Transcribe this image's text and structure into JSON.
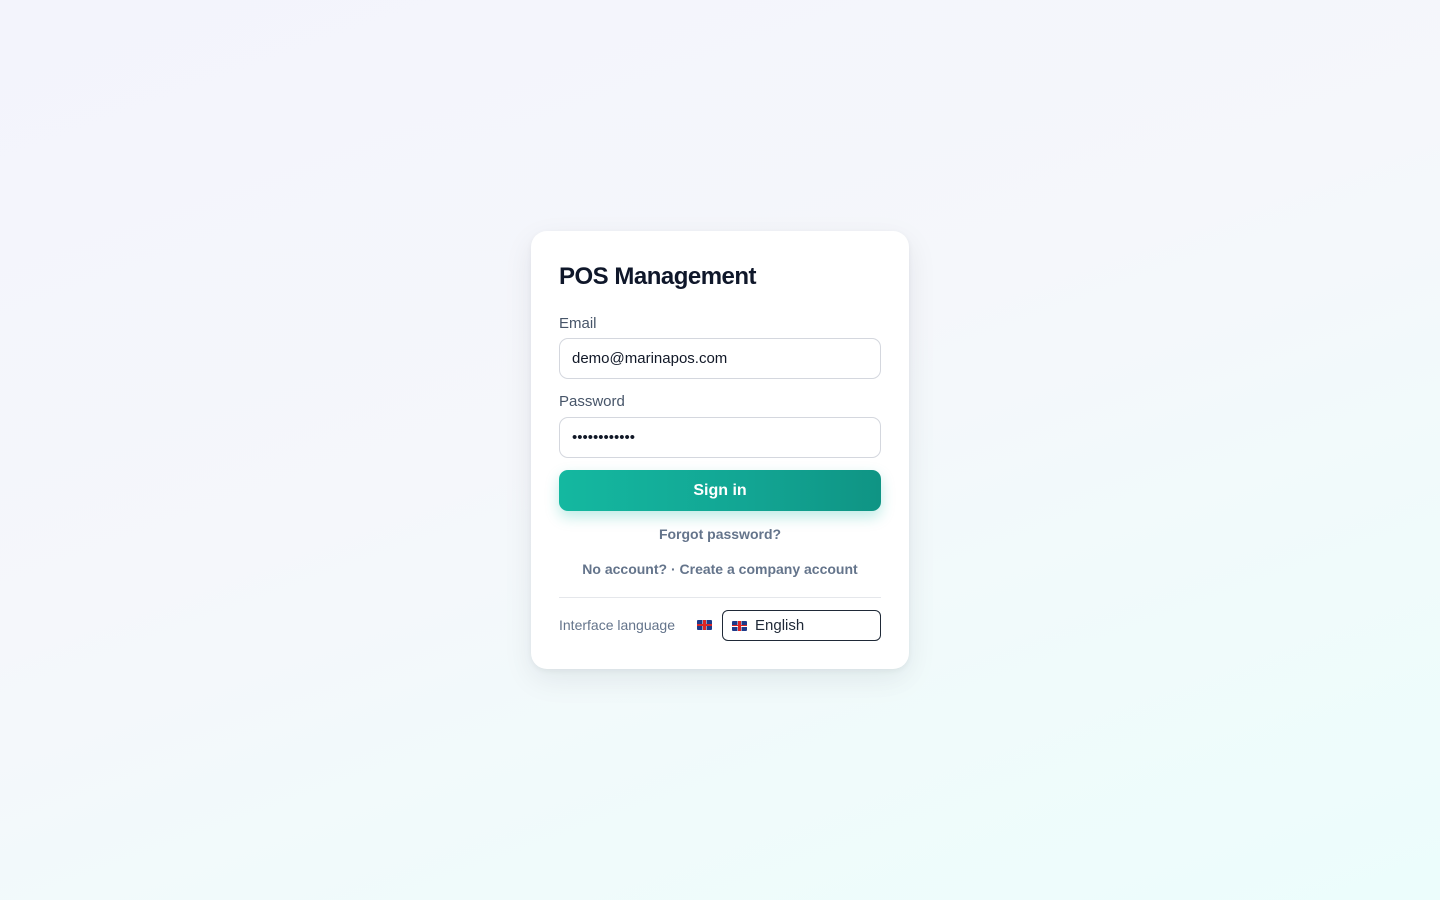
{
  "login": {
    "title": "POS Management",
    "email_label": "Email",
    "email_value": "demo@marinapos.com",
    "password_label": "Password",
    "password_value": "demopassword",
    "sign_in_label": "Sign in",
    "forgot_password": "Forgot password?",
    "create_account": "No account? · Create a company account"
  },
  "language": {
    "label": "Interface language",
    "selected": "English",
    "flag_icon": "uk-flag-icon"
  },
  "colors": {
    "accent": "#14b8a0",
    "title": "#0f172a",
    "muted": "#64748b"
  }
}
